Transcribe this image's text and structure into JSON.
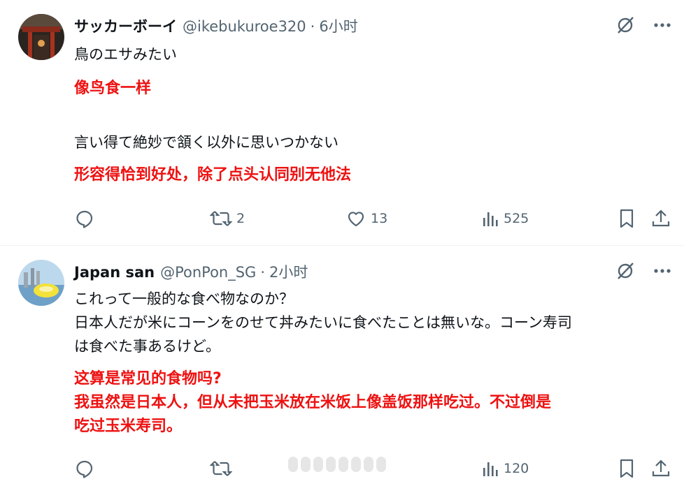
{
  "tweets": [
    {
      "name": "サッカーボーイ",
      "handle": "@ikebukuroe320",
      "dot": "·",
      "time": "6小时",
      "lines": [
        {
          "kind": "jp",
          "text": "鳥のエサみたい"
        },
        {
          "kind": "cn",
          "text": "像鸟食一样"
        },
        {
          "kind": "jp",
          "text": "言い得て絶妙で頷く以外に思いつかない"
        },
        {
          "kind": "cn",
          "text": "形容得恰到好处，除了点头认同别无他法"
        }
      ],
      "stats": {
        "replies": "",
        "retweets": "2",
        "likes": "13",
        "views": "525"
      }
    },
    {
      "name": "Japan san",
      "handle": "@PonPon_SG",
      "dot": "·",
      "time": "2小时",
      "lines": [
        {
          "kind": "jp",
          "text": "これって一般的な食べ物なのか？"
        },
        {
          "kind": "jp",
          "text": "日本人だが米にコーンをのせて丼みたいに食べたことは無いな。コーン寿司"
        },
        {
          "kind": "jp",
          "text": "は食べた事あるけど。"
        },
        {
          "kind": "cn",
          "text": "这算是常见的食物吗?"
        },
        {
          "kind": "cn",
          "text": "我虽然是日本人，但从未把玉米放在米饭上像盖饭那样吃过。不过倒是"
        },
        {
          "kind": "cn",
          "text": "吃过玉米寿司。"
        }
      ],
      "stats": {
        "replies": "",
        "retweets": "",
        "likes": "",
        "views": "120"
      }
    }
  ],
  "colors": {
    "translation": "#ee1111",
    "muted": "#536471",
    "text": "#0f1419"
  },
  "icons": [
    "grok-icon",
    "more-icon",
    "reply-icon",
    "retweet-icon",
    "like-icon",
    "views-icon",
    "bookmark-icon",
    "share-icon"
  ]
}
